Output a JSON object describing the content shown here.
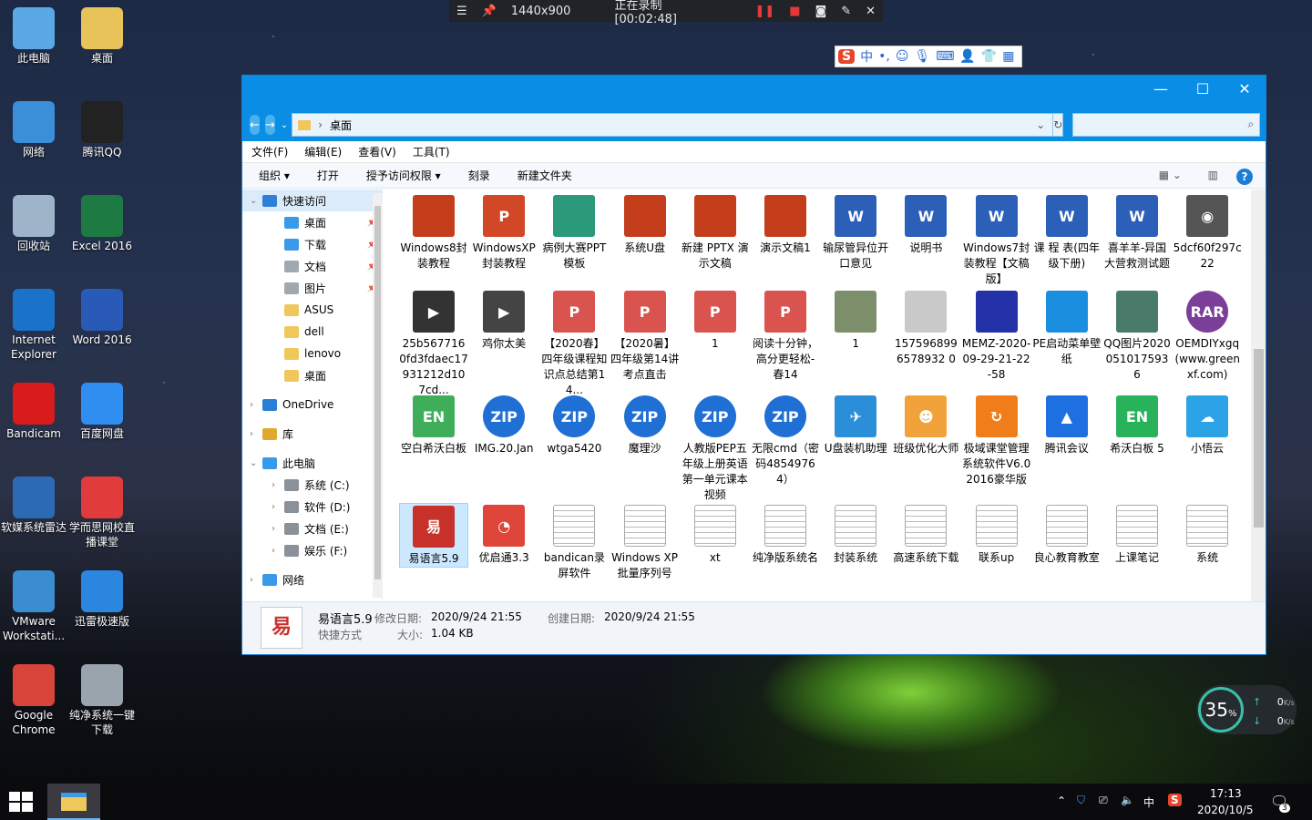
{
  "recorder": {
    "resolution": "1440x900",
    "status": "正在录制 [00:02:48]"
  },
  "ime": {
    "logo": "S",
    "mode": "中",
    "punct": "•,"
  },
  "desktop_icons": [
    {
      "label": "此电脑",
      "name": "desktop-icon-this-pc",
      "color": "#5aa9e6"
    },
    {
      "label": "桌面",
      "name": "desktop-icon-desktop-folder",
      "color": "#e8c35a"
    },
    {
      "label": "网络",
      "name": "desktop-icon-network",
      "color": "#3b8fd8"
    },
    {
      "label": "腾讯QQ",
      "name": "desktop-icon-qq",
      "color": "#222"
    },
    {
      "label": "回收站",
      "name": "desktop-icon-recycle-bin",
      "color": "#9fb4c8"
    },
    {
      "label": "Excel 2016",
      "name": "desktop-icon-excel",
      "color": "#1d7a43"
    },
    {
      "label": "Internet Explorer",
      "name": "desktop-icon-ie",
      "color": "#1b73c9"
    },
    {
      "label": "Word 2016",
      "name": "desktop-icon-word",
      "color": "#2a5ab8"
    },
    {
      "label": "Bandicam",
      "name": "desktop-icon-bandicam",
      "color": "#d81c1c"
    },
    {
      "label": "百度网盘",
      "name": "desktop-icon-baidu-netdisk",
      "color": "#2f8ef0"
    },
    {
      "label": "软媒系统雷达",
      "name": "desktop-icon-radar",
      "color": "#2d6ab5"
    },
    {
      "label": "学而思网校直播课堂",
      "name": "desktop-icon-xueersi",
      "color": "#e23b3b"
    },
    {
      "label": "VMware Workstati...",
      "name": "desktop-icon-vmware",
      "color": "#3a8dd0"
    },
    {
      "label": "迅雷极速版",
      "name": "desktop-icon-thunder",
      "color": "#2b86df"
    },
    {
      "label": "Google Chrome",
      "name": "desktop-icon-chrome",
      "color": "#d9443a"
    },
    {
      "label": "纯净系统一键下载",
      "name": "desktop-icon-pure-system",
      "color": "#9aa4ad"
    }
  ],
  "window": {
    "address_path": "桌面",
    "menu": [
      "文件(F)",
      "编辑(E)",
      "查看(V)",
      "工具(T)"
    ],
    "toolbar": [
      "组织 ▾",
      "打开",
      "授予访问权限 ▾",
      "刻录",
      "新建文件夹"
    ],
    "nav": [
      {
        "label": "快速访问",
        "indent": 0,
        "color": "#2d7fd8",
        "expanded": "⌄"
      },
      {
        "label": "桌面",
        "indent": 1,
        "color": "#3b9ae8",
        "pin": "true"
      },
      {
        "label": "下载",
        "indent": 1,
        "color": "#3b9ae8",
        "pin": "true"
      },
      {
        "label": "文档",
        "indent": 1,
        "color": "#a0a8b0",
        "pin": "true"
      },
      {
        "label": "图片",
        "indent": 1,
        "color": "#a0a8b0",
        "pin": "true"
      },
      {
        "label": "ASUS",
        "indent": 1,
        "color": "#f0c75a"
      },
      {
        "label": "dell",
        "indent": 1,
        "color": "#f0c75a"
      },
      {
        "label": "lenovo",
        "indent": 1,
        "color": "#f0c75a"
      },
      {
        "label": "桌面",
        "indent": 1,
        "color": "#f0c75a"
      },
      {
        "label": "OneDrive",
        "indent": 0,
        "color": "#2a7fd4",
        "expanded": "›"
      },
      {
        "label": "库",
        "indent": 0,
        "color": "#e0a830",
        "expanded": "›"
      },
      {
        "label": "此电脑",
        "indent": 0,
        "color": "#3b9ae8",
        "expanded": "⌄"
      },
      {
        "label": "系统 (C:)",
        "indent": 1,
        "color": "#8a9198",
        "expanded": "›"
      },
      {
        "label": "软件 (D:)",
        "indent": 1,
        "color": "#8a9198",
        "expanded": "›"
      },
      {
        "label": "文档 (E:)",
        "indent": 1,
        "color": "#8a9198",
        "expanded": "›"
      },
      {
        "label": "娱乐 (F:)",
        "indent": 1,
        "color": "#8a9198",
        "expanded": "›"
      },
      {
        "label": "网络",
        "indent": 0,
        "color": "#3b9ae8",
        "expanded": "›"
      }
    ],
    "files": [
      {
        "label": "Windows8封装教程",
        "type": "ppt",
        "color": "#c43e1c",
        "glyph": ""
      },
      {
        "label": "WindowsXP封装教程",
        "type": "ppt",
        "color": "#d24726",
        "glyph": "P"
      },
      {
        "label": "病例大赛PPT模板",
        "type": "ppt",
        "color": "#2a9a7a",
        "glyph": ""
      },
      {
        "label": "系统U盘",
        "type": "ppt",
        "color": "#c43e1c",
        "glyph": ""
      },
      {
        "label": "新建 PPTX 演示文稿",
        "type": "ppt",
        "color": "#c43e1c",
        "glyph": ""
      },
      {
        "label": "演示文稿1",
        "type": "ppt",
        "color": "#c43e1c",
        "glyph": ""
      },
      {
        "label": "输尿管异位开口意见",
        "type": "word",
        "color": "#2b5fb8",
        "glyph": "W"
      },
      {
        "label": "说明书",
        "type": "word",
        "color": "#2b5fb8",
        "glyph": "W"
      },
      {
        "label": "Windows7封装教程【文稿版】",
        "type": "word",
        "color": "#2b5fb8",
        "glyph": "W"
      },
      {
        "label": "课 程 表(四年级下册)",
        "type": "word",
        "color": "#2b5fb8",
        "glyph": "W"
      },
      {
        "label": "喜羊羊-异国大营救测试题",
        "type": "word",
        "color": "#2b5fb8",
        "glyph": "W"
      },
      {
        "label": "5dcf60f297c22",
        "type": "media",
        "color": "#555",
        "glyph": "◉"
      },
      {
        "label": "25b5677160fd3fdaec17931212d107cd...",
        "type": "video",
        "color": "#333",
        "glyph": "▶"
      },
      {
        "label": "鸡你太美",
        "type": "video",
        "color": "#444",
        "glyph": "▶"
      },
      {
        "label": "【2020春】四年级课程知识点总结第14...",
        "type": "pdf",
        "color": "#d9534f",
        "glyph": "P"
      },
      {
        "label": "【2020暑】四年级第14讲考点直击",
        "type": "pdf",
        "color": "#d9534f",
        "glyph": "P"
      },
      {
        "label": "1",
        "type": "pdf",
        "color": "#d9534f",
        "glyph": "P"
      },
      {
        "label": "阅读十分钟，高分更轻松-春14",
        "type": "pdf",
        "color": "#d9534f",
        "glyph": "P"
      },
      {
        "label": "1",
        "type": "image",
        "color": "#7c8f6a",
        "glyph": ""
      },
      {
        "label": "1575968996578932 0",
        "type": "image",
        "color": "#c9c9c9",
        "glyph": ""
      },
      {
        "label": "MEMZ-2020-09-29-21-22-58",
        "type": "image",
        "color": "#2431a8",
        "glyph": ""
      },
      {
        "label": "PE启动菜单壁纸",
        "type": "image",
        "color": "#1a8fe0",
        "glyph": ""
      },
      {
        "label": "QQ图片20200510175936",
        "type": "image",
        "color": "#4a7a6a",
        "glyph": ""
      },
      {
        "label": "OEMDIYxgq(www.greenxf.com)",
        "type": "rar",
        "color": "#7b3f9a",
        "glyph": "RAR"
      },
      {
        "label": "空白希沃白板",
        "type": "enb",
        "color": "#3fae5a",
        "glyph": "EN"
      },
      {
        "label": "IMG.20.Jan",
        "type": "zip",
        "color": "#1f6fd4",
        "glyph": "ZIP"
      },
      {
        "label": "wtga5420",
        "type": "zip",
        "color": "#1f6fd4",
        "glyph": "ZIP"
      },
      {
        "label": "魔理沙",
        "type": "zip",
        "color": "#1f6fd4",
        "glyph": "ZIP"
      },
      {
        "label": "人教版PEP五年级上册英语第一单元课本视频",
        "type": "zip",
        "color": "#1f6fd4",
        "glyph": "ZIP"
      },
      {
        "label": "无限cmd（密码48549764）",
        "type": "zip",
        "color": "#1f6fd4",
        "glyph": "ZIP"
      },
      {
        "label": "U盘装机助理",
        "type": "app",
        "color": "#2a8fd8",
        "glyph": "✈"
      },
      {
        "label": "班级优化大师",
        "type": "app",
        "color": "#f2a23a",
        "glyph": "☻"
      },
      {
        "label": "极域课堂管理系统软件V6.0 2016豪华版",
        "type": "app",
        "color": "#f07d1a",
        "glyph": "↻"
      },
      {
        "label": "腾讯会议",
        "type": "app",
        "color": "#1e6fe0",
        "glyph": "▲"
      },
      {
        "label": "希沃白板 5",
        "type": "app",
        "color": "#28b25a",
        "glyph": "EN"
      },
      {
        "label": "小悟云",
        "type": "app",
        "color": "#2ba3e6",
        "glyph": "☁"
      },
      {
        "label": "易语言5.9",
        "type": "shortcut",
        "color": "#c8302a",
        "glyph": "易",
        "selected": "true"
      },
      {
        "label": "优启通3.3",
        "type": "app",
        "color": "#e0453a",
        "glyph": "◔"
      },
      {
        "label": "bandican录屏软件",
        "type": "txt",
        "color": "#ddd",
        "glyph": ""
      },
      {
        "label": "Windows XP批量序列号",
        "type": "txt",
        "color": "#ddd",
        "glyph": ""
      },
      {
        "label": "xt",
        "type": "txt",
        "color": "#ddd",
        "glyph": ""
      },
      {
        "label": "纯净版系统名",
        "type": "txt",
        "color": "#ddd",
        "glyph": ""
      },
      {
        "label": "封装系统",
        "type": "txt",
        "color": "#ddd",
        "glyph": ""
      },
      {
        "label": "高速系统下载",
        "type": "txt",
        "color": "#ddd",
        "glyph": ""
      },
      {
        "label": "联系up",
        "type": "txt",
        "color": "#ddd",
        "glyph": ""
      },
      {
        "label": "良心教育教室",
        "type": "txt",
        "color": "#ddd",
        "glyph": ""
      },
      {
        "label": "上课笔记",
        "type": "txt",
        "color": "#ddd",
        "glyph": ""
      },
      {
        "label": "系统",
        "type": "txt",
        "color": "#ddd",
        "glyph": ""
      }
    ],
    "details": {
      "name": "易语言5.9",
      "type": "快捷方式",
      "modified_label": "修改日期:",
      "modified": "2020/9/24 21:55",
      "created_label": "创建日期:",
      "created": "2020/9/24 21:55",
      "size_label": "大小:",
      "size": "1.04 KB"
    }
  },
  "gauge": {
    "percent": "35",
    "unit": "%",
    "up": "0",
    "down": "0",
    "rate_unit": "K/s"
  },
  "taskbar": {
    "time": "17:13",
    "date": "2020/10/5",
    "ime": "中",
    "notifications": "3"
  }
}
